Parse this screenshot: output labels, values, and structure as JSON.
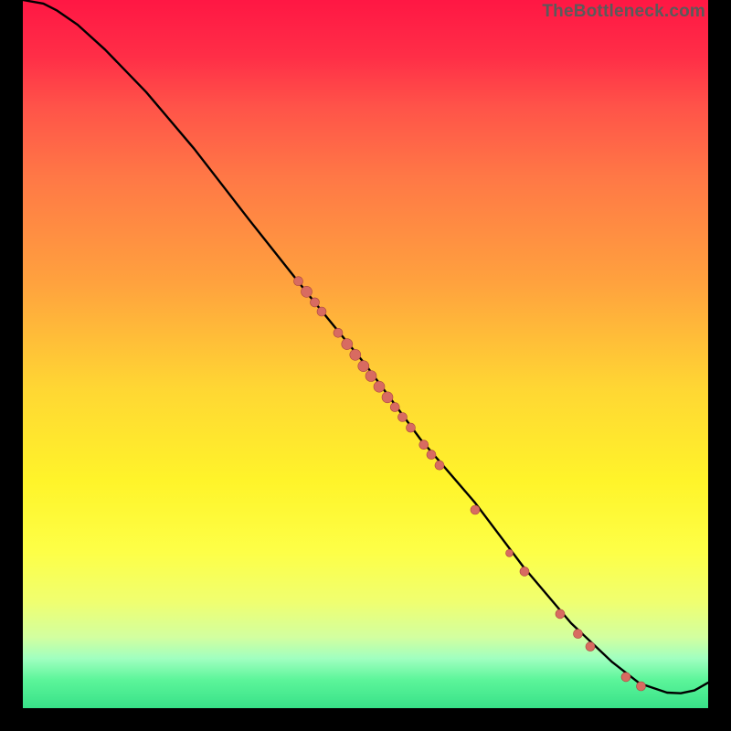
{
  "watermark": "TheBottleneck.com",
  "colors": {
    "bg": "#000000",
    "curve": "#000000",
    "dot_fill": "#d86b61",
    "dot_stroke": "#a9453f"
  },
  "chart_data": {
    "type": "line",
    "title": "",
    "xlabel": "",
    "ylabel": "",
    "xlim": [
      0,
      100
    ],
    "ylim": [
      0,
      100
    ],
    "curve": {
      "x": [
        0,
        3,
        5,
        8,
        12,
        18,
        25,
        33,
        42,
        50,
        58,
        66,
        73,
        80,
        86,
        90,
        94,
        96,
        98,
        100
      ],
      "y": [
        100,
        99.5,
        98.5,
        96.5,
        93,
        87,
        79,
        69,
        58,
        48.5,
        38,
        29,
        20,
        12,
        6.5,
        3.5,
        2.2,
        2.1,
        2.5,
        3.6
      ]
    },
    "dot_clusters": [
      {
        "x": 40.2,
        "y": 60.3,
        "r": 5
      },
      {
        "x": 41.4,
        "y": 58.8,
        "r": 6
      },
      {
        "x": 42.6,
        "y": 57.3,
        "r": 5
      },
      {
        "x": 43.6,
        "y": 56.0,
        "r": 5
      },
      {
        "x": 46.0,
        "y": 53.0,
        "r": 5
      },
      {
        "x": 47.3,
        "y": 51.4,
        "r": 6
      },
      {
        "x": 48.5,
        "y": 49.9,
        "r": 6
      },
      {
        "x": 49.7,
        "y": 48.3,
        "r": 6
      },
      {
        "x": 50.8,
        "y": 46.9,
        "r": 6
      },
      {
        "x": 52.0,
        "y": 45.4,
        "r": 6
      },
      {
        "x": 53.2,
        "y": 43.9,
        "r": 6
      },
      {
        "x": 54.3,
        "y": 42.5,
        "r": 5
      },
      {
        "x": 55.4,
        "y": 41.1,
        "r": 5
      },
      {
        "x": 56.6,
        "y": 39.6,
        "r": 5
      },
      {
        "x": 58.5,
        "y": 37.2,
        "r": 5
      },
      {
        "x": 59.6,
        "y": 35.8,
        "r": 5
      },
      {
        "x": 60.8,
        "y": 34.3,
        "r": 5
      },
      {
        "x": 66.0,
        "y": 28.0,
        "r": 5
      },
      {
        "x": 71.0,
        "y": 21.9,
        "r": 4
      },
      {
        "x": 73.2,
        "y": 19.3,
        "r": 5
      },
      {
        "x": 78.4,
        "y": 13.3,
        "r": 5
      },
      {
        "x": 81.0,
        "y": 10.5,
        "r": 5
      },
      {
        "x": 82.8,
        "y": 8.7,
        "r": 5
      },
      {
        "x": 88.0,
        "y": 4.4,
        "r": 5
      },
      {
        "x": 90.2,
        "y": 3.1,
        "r": 5
      }
    ]
  }
}
